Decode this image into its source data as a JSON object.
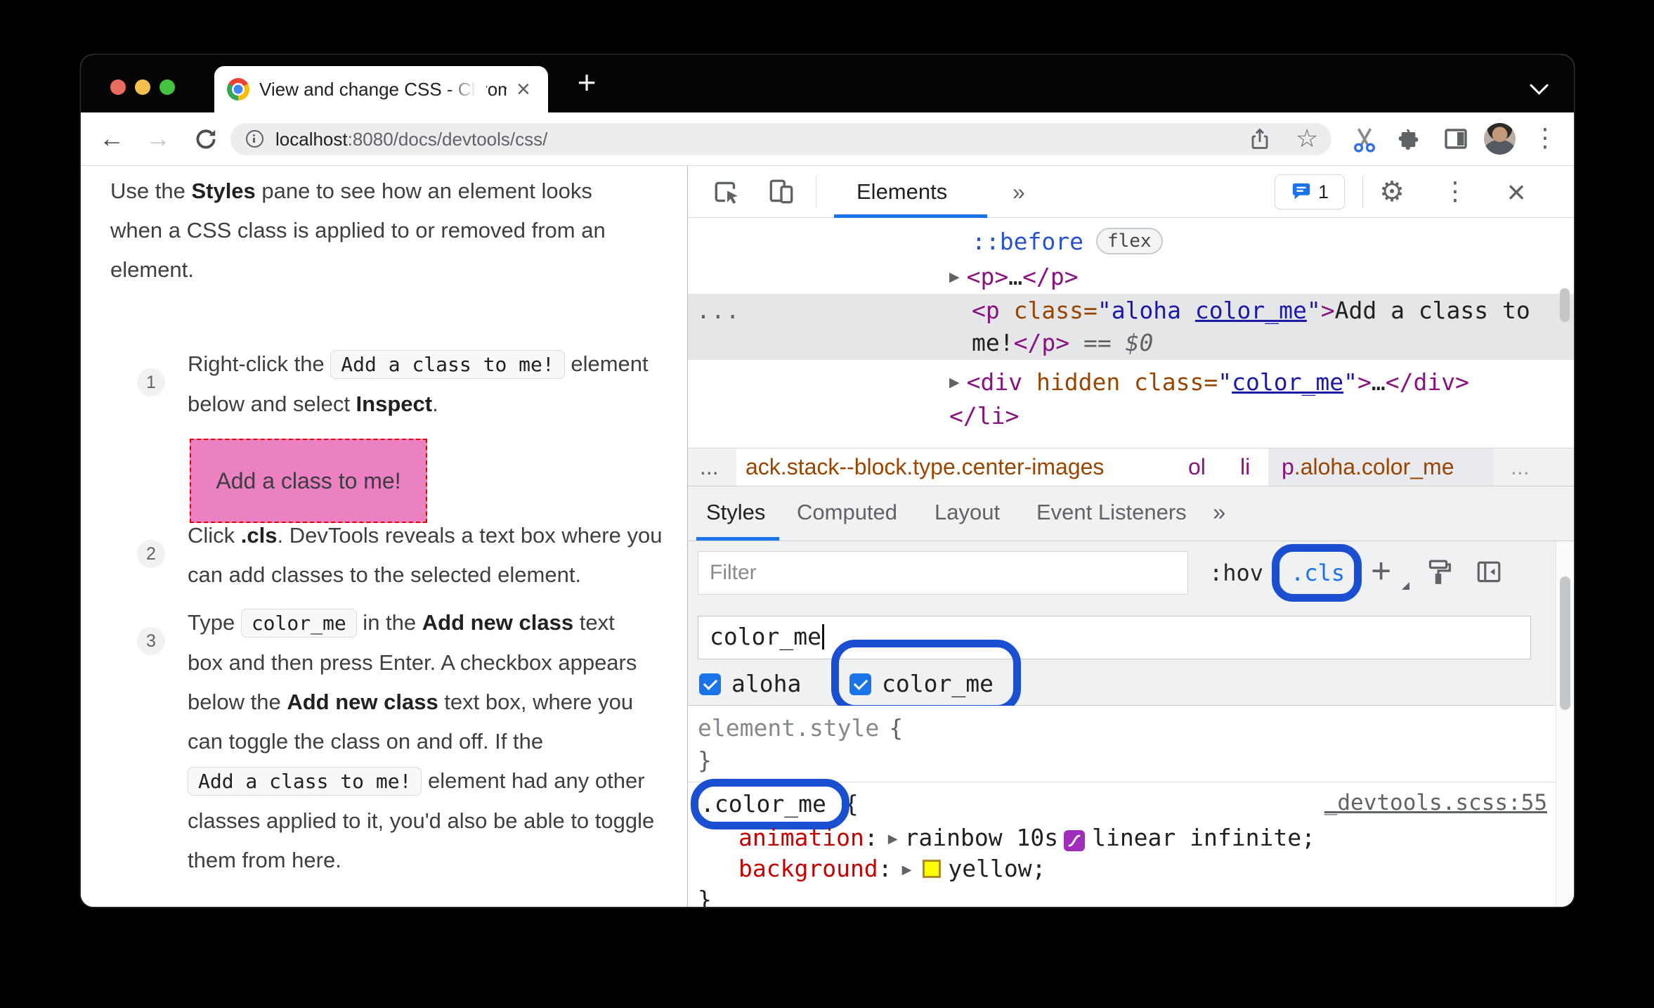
{
  "colors": {
    "annotation": "#1a4fd2",
    "accent": "#1a73e8",
    "tag": "#881280",
    "attr": "#994500",
    "value": "#1a1aa6",
    "pseudo": "#2553cf",
    "property": "#c80000",
    "pink_bg": "#ec81c1",
    "pink_border": "#e00000",
    "swatch": "#ffff00",
    "bezier_purple": "#a32dbb",
    "selected_row": "#e5e6e8",
    "light_red": "#ed6a5e",
    "light_yellow": "#f5bf4f",
    "light_green": "#45c33f"
  },
  "glyphs": {
    "back": "←",
    "forward": "→",
    "star": "☆",
    "kebab": "⋮",
    "gear": "⚙",
    "plus": "+",
    "close": "×",
    "expand_arrow": "▶",
    "dots": "..."
  },
  "browser": {
    "tab_title": "View and change CSS - Chrome",
    "url_host": "localhost",
    "url_path": ":8080/docs/devtools/css/"
  },
  "article": {
    "intro_pre": "Use the ",
    "intro_bold": "Styles",
    "intro_post": " pane to see how an element looks when a CSS class is applied to or removed from an element.",
    "step1_num": "1",
    "step1_t1": "Right-click the ",
    "step1_code": "Add a class to me!",
    "step1_t2": " element below and select ",
    "step1_b": "Inspect",
    "step1_t3": ".",
    "demo_text": "Add a class to me!",
    "step2_num": "2",
    "step2_t1": "Click ",
    "step2_b": ".cls",
    "step2_t2": ". DevTools reveals a text box where you can add classes to the selected element.",
    "step3_num": "3",
    "step3_t1": "Type ",
    "step3_code": "color_me",
    "step3_t2": " in the ",
    "step3_b1": "Add new class",
    "step3_t3": " text box and then press Enter. A checkbox appears below the ",
    "step3_b2": "Add new class",
    "step3_t4": " text box, where you can toggle the class on and off. If the ",
    "step3_code2": "Add a class to me!",
    "step3_t5": " element had any other classes applied to it, you'd also be able to toggle them from here."
  },
  "devtools": {
    "panel_tab": "Elements",
    "more_tabs": "»",
    "messages_count": "1",
    "dom": {
      "r1_pseudo": "::before",
      "r1_badge": "flex",
      "r2_open": "<p>",
      "r2_ellipsis": "…",
      "r2_close": "</p>",
      "sel_gutter": "...",
      "sel_tag": "<p",
      "sel_attr": " class=",
      "sel_val_a": "\"aloha ",
      "sel_val_hl": "color_me",
      "sel_val_b": "\"",
      "sel_gt": ">",
      "sel_text1": "Add a class to",
      "sel_text2": "me!",
      "sel_close": "</p>",
      "sel_eq": "==",
      "sel_ret": "$0",
      "r4_tag": "<div",
      "r4_attrs": " hidden class=",
      "r4_q1": "\"",
      "r4_val": "color_me",
      "r4_q2": "\"",
      "r4_gt": ">",
      "r4_ellipsis": "…",
      "r4_close": "</div>",
      "r5_close": "</li>"
    },
    "crumbs": {
      "left_dots": "...",
      "c1": "ack.stack--block.type.center-images",
      "c2": "ol",
      "c3": "li",
      "c4_tag": "p",
      "c4_classes": ".aloha.color_me",
      "right_dots": "..."
    },
    "pane_tabs": [
      "Styles",
      "Computed",
      "Layout",
      "Event Listeners"
    ],
    "pane_more": "»",
    "filter_placeholder": "Filter",
    "hov_label": ":hov",
    "cls_label": ".cls",
    "class_input_value": "color_me",
    "checkbox1_label": "aloha",
    "checkbox2_label": "color_me",
    "styles": {
      "elem_selector": "element.style",
      "elem_open": "{",
      "elem_close": "}",
      "rule_selector": ".color_me",
      "rule_open": "{",
      "rule_source": "_devtools.scss:55",
      "colon": ":",
      "p1_name": "animation",
      "p1_v1": "rainbow 10s",
      "p1_v2": "linear infinite;",
      "p2_name": "background",
      "p2_v": "yellow;",
      "rule_close": "}"
    }
  }
}
